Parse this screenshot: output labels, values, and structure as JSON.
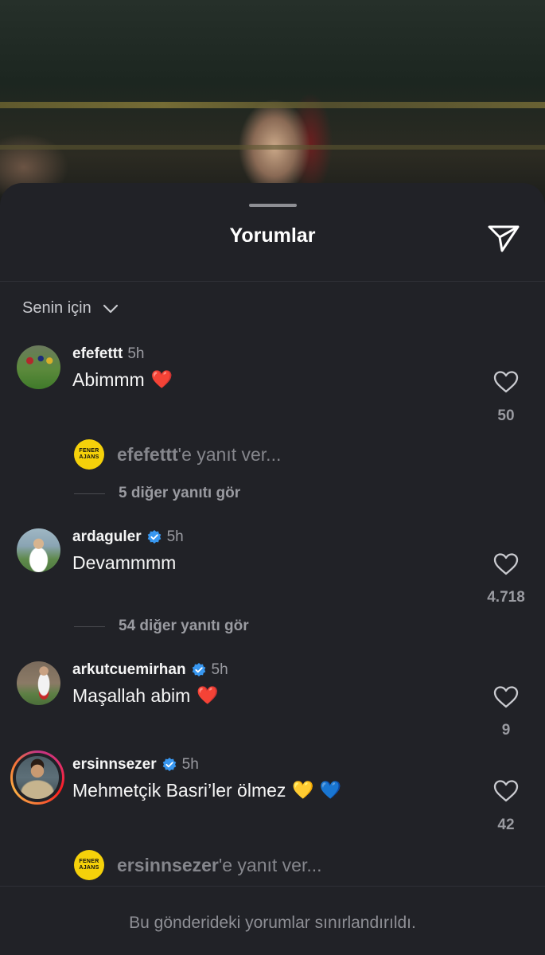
{
  "sheet": {
    "title": "Yorumlar",
    "filter_label": "Senin için",
    "footer_text": "Bu gönderideki yorumlar sınırlandırıldı."
  },
  "comments": [
    {
      "username": "efefettt",
      "time": "5h",
      "verified": false,
      "text": "Abimmm",
      "emoji": "❤️",
      "likes": "50",
      "reply_prompt_user": "efefettt",
      "reply_prompt_suffix": "'e yanıt ver...",
      "more_replies": "5 diğer yanıtı gör"
    },
    {
      "username": "ardaguler",
      "time": "5h",
      "verified": true,
      "text": "Devammmm",
      "likes": "4.718",
      "more_replies": "54 diğer yanıtı gör"
    },
    {
      "username": "arkutcuemirhan",
      "time": "5h",
      "verified": true,
      "text": "Maşallah abim",
      "emoji": "❤️",
      "likes": "9"
    },
    {
      "username": "ersinnsezer",
      "time": "5h",
      "verified": true,
      "text": "Mehmetçik Basri’ler ölmez",
      "emoji": "💛 💙",
      "likes": "42",
      "reply_prompt_user": "ersinnsezer",
      "reply_prompt_suffix": "'e yanıt ver..."
    }
  ],
  "reply_avatar": {
    "line1": "FENER",
    "line2": "AJANS"
  },
  "colors": {
    "sheet_bg": "#212227",
    "verified_blue": "#3897f0",
    "reply_badge_yellow": "#f5d10a"
  },
  "icons": [
    "send-icon",
    "chevron-down-icon",
    "heart-outline-icon",
    "verified-badge-icon"
  ]
}
